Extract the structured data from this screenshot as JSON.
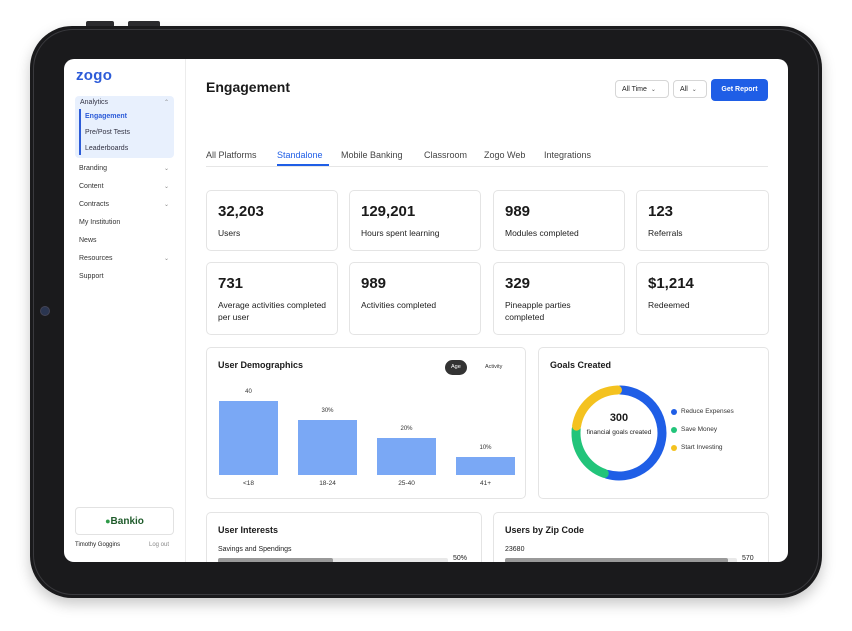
{
  "app": {
    "logo": "zogo"
  },
  "sidebar": {
    "group_label": "Analytics",
    "sub_items": [
      "Engagement",
      "Pre/Post Tests",
      "Leaderboards"
    ],
    "items": [
      {
        "label": "Branding",
        "has_chevron": true
      },
      {
        "label": "Content",
        "has_chevron": true
      },
      {
        "label": "Contracts",
        "has_chevron": true
      },
      {
        "label": "My Institution",
        "has_chevron": false
      },
      {
        "label": "News",
        "has_chevron": false
      },
      {
        "label": "Resources",
        "has_chevron": true
      },
      {
        "label": "Support",
        "has_chevron": false
      }
    ],
    "partner": "Bankio",
    "user_name": "Timothy Goggins",
    "logout": "Log out"
  },
  "header": {
    "title": "Engagement",
    "filter_time": "All Time",
    "filter_platform": "All",
    "report_button": "Get Report"
  },
  "tabs": [
    "All Platforms",
    "Standalone",
    "Mobile Banking",
    "Classroom",
    "Zogo Web",
    "Integrations"
  ],
  "active_tab": "Standalone",
  "stats": [
    {
      "value": "32,203",
      "label": "Users"
    },
    {
      "value": "129,201",
      "label": "Hours spent learning"
    },
    {
      "value": "989",
      "label": "Modules completed"
    },
    {
      "value": "123",
      "label": "Referrals"
    },
    {
      "value": "731",
      "label": "Average activities completed per user"
    },
    {
      "value": "989",
      "label": "Activities completed"
    },
    {
      "value": "329",
      "label": "Pineapple parties completed"
    },
    {
      "value": "$1,214",
      "label": "Redeemed"
    }
  ],
  "demographics": {
    "title": "User Demographics",
    "toggle_on": "Age",
    "toggle_off": "Activity"
  },
  "goals": {
    "title": "Goals Created",
    "total": "300",
    "caption": "financial goals created",
    "legend": [
      {
        "label": "Reduce Expenses",
        "color": "#1f5ee6"
      },
      {
        "label": "Save Money",
        "color": "#22c47a"
      },
      {
        "label": "Start Investing",
        "color": "#f4c21f"
      }
    ]
  },
  "interests": {
    "title": "User Interests",
    "row_label": "Savings and Spendings",
    "row_value": "50%",
    "row_fraction": 0.5
  },
  "zip": {
    "title": "Users by Zip Code",
    "row_label": "23680",
    "row_value": "570",
    "row_fraction": 0.96
  },
  "chart_data": [
    {
      "type": "bar",
      "title": "User Demographics",
      "categories": [
        "<18",
        "18-24",
        "25-40",
        "41+"
      ],
      "values": [
        40,
        30,
        20,
        10
      ],
      "data_labels": [
        "40",
        "30%",
        "20%",
        "10%"
      ],
      "ylim": [
        0,
        40
      ],
      "color": "#7aa8f5"
    },
    {
      "type": "pie",
      "title": "Goals Created",
      "categories": [
        "Reduce Expenses",
        "Save Money",
        "Start Investing"
      ],
      "values": [
        55,
        22,
        23
      ],
      "colors": [
        "#1f5ee6",
        "#22c47a",
        "#f4c21f"
      ]
    }
  ]
}
